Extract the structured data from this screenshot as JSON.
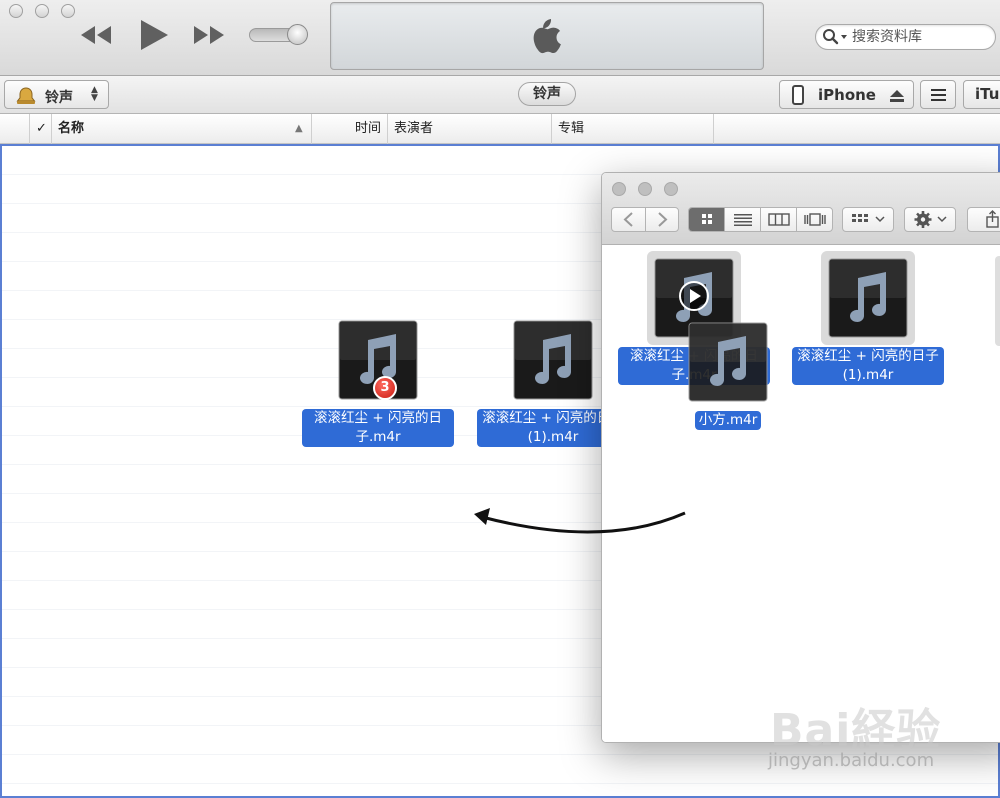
{
  "toolbar": {
    "search_placeholder": "搜索资料库"
  },
  "navbar": {
    "media_type": "铃声",
    "center_label": "铃声",
    "device_name": "iPhone",
    "store_label": "iTunes Store"
  },
  "columns": {
    "check": "✓",
    "name": "名称",
    "time": "时间",
    "artist": "表演者",
    "album": "专辑"
  },
  "drag_items": {
    "badge_count": "3",
    "item1_label": "滚滚红尘 + 闪亮的日子.m4r",
    "item2_label": "滚滚红尘 + 闪亮的日子(1).m4r"
  },
  "finder": {
    "file1_label": "滚滚红尘 + 闪亮的日子.m4r",
    "file2_label": "滚滚红尘 + 闪亮的日子(1).m4r",
    "file3_label": "小方.m4r"
  },
  "watermark": {
    "brand": "Bai経验",
    "url": "jingyan.baidu.com"
  },
  "colors": {
    "selection_blue": "#2f6bd6",
    "drop_border": "#5b7fd3",
    "badge_red": "#d6241a"
  }
}
